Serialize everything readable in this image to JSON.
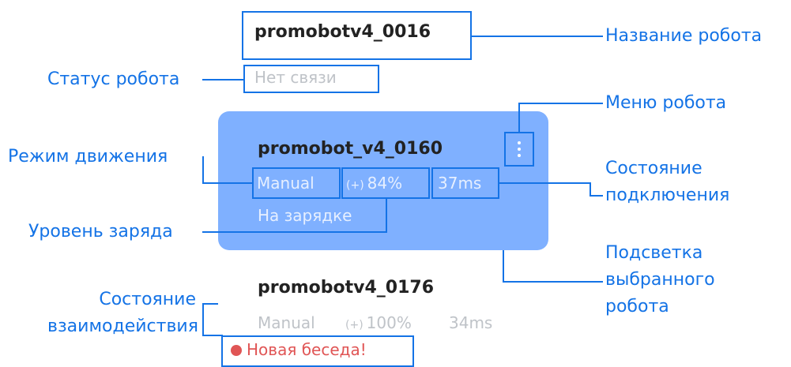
{
  "callouts": {
    "robot_name": "Название робота",
    "robot_status": "Статус робота",
    "robot_menu": "Меню робота",
    "motion_mode": "Режим движения",
    "connection_state_l1": "Состояние",
    "connection_state_l2": "подключения",
    "charge_level": "Уровень заряда",
    "selected_highlight_l1": "Подсветка",
    "selected_highlight_l2": "выбранного",
    "selected_highlight_l3": "робота",
    "interaction_state_l1": "Состояние",
    "interaction_state_l2": "взаимодействия"
  },
  "robot1": {
    "name": "promobotv4_0016",
    "status": "Нет связи"
  },
  "robot2": {
    "name": "promobot_v4_0160",
    "mode": "Manual",
    "battery_icon": "(+)",
    "battery": "84%",
    "ping": "37ms",
    "status": "На зарядке",
    "menu_icon": "kebab-menu-icon"
  },
  "robot3": {
    "name": "promobotv4_0176",
    "mode": "Manual",
    "battery_icon": "(+)",
    "battery": "100%",
    "ping": "34ms",
    "interaction": "Новая беседа!"
  },
  "colors": {
    "accent": "#1473e6",
    "card_bg": "#7fb0ff",
    "muted": "#bfc3c8",
    "alert": "#e05555"
  }
}
